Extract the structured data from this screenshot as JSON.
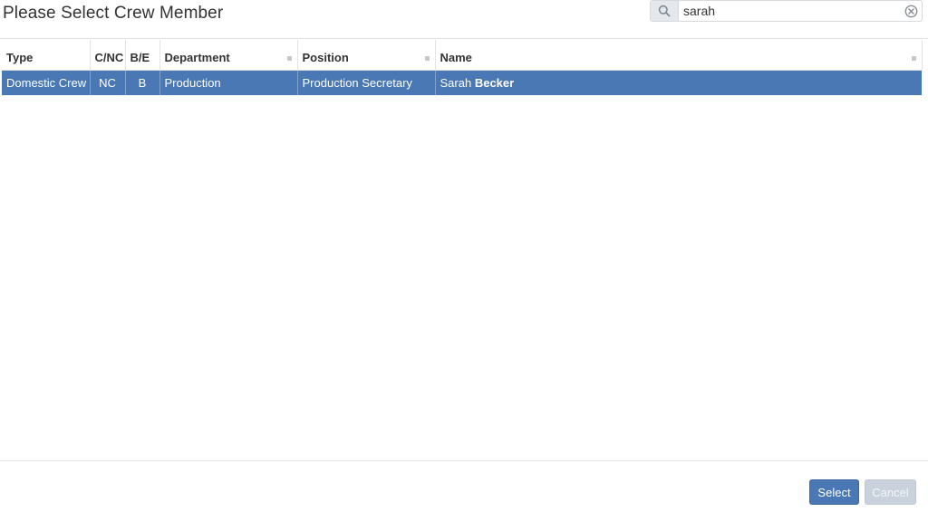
{
  "dialog": {
    "title": "Please Select Crew Member"
  },
  "search": {
    "value": "sarah",
    "placeholder": ""
  },
  "table": {
    "columns": [
      {
        "label": "Type",
        "sortable": false
      },
      {
        "label": "C/NC",
        "sortable": false
      },
      {
        "label": "B/E",
        "sortable": false
      },
      {
        "label": "Department",
        "sortable": true
      },
      {
        "label": "Position",
        "sortable": true
      },
      {
        "label": "Name",
        "sortable": true
      }
    ],
    "rows": [
      {
        "type": "Domestic Crew",
        "cnc": "NC",
        "be": "B",
        "department": "Production",
        "position": "Production Secretary",
        "first_name": "Sarah",
        "last_name": "Becker",
        "selected": true
      }
    ]
  },
  "footer": {
    "select_label": "Select",
    "cancel_label": "Cancel"
  },
  "colors": {
    "accent": "#4a78b5",
    "disabled": "#c9d2dc"
  },
  "icons": {
    "search": "search-icon",
    "clear": "clear-search-icon",
    "sort": "sort-indicator-icon"
  }
}
